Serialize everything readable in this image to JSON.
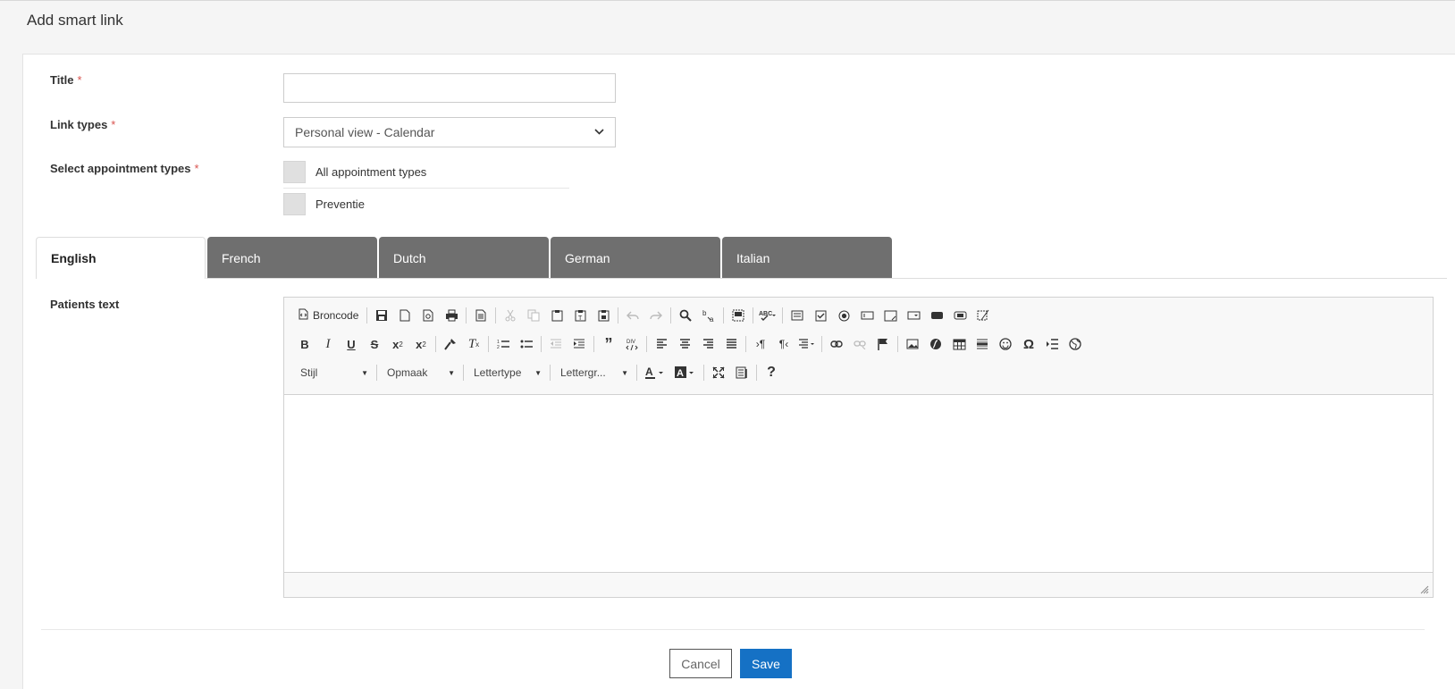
{
  "page": {
    "title": "Add smart link"
  },
  "form": {
    "title": {
      "label": "Title",
      "required": "*",
      "value": "",
      "placeholder": ""
    },
    "link_types": {
      "label": "Link types",
      "required": "*",
      "selected": "Personal view - Calendar"
    },
    "appointment_types": {
      "label": "Select appointment types",
      "required": "*",
      "options": [
        {
          "label": "All appointment types",
          "checked": false
        },
        {
          "label": "Preventie",
          "checked": false
        }
      ]
    },
    "patients_text": {
      "label": "Patients text"
    }
  },
  "tabs": [
    {
      "label": "English",
      "active": true
    },
    {
      "label": "French",
      "active": false
    },
    {
      "label": "Dutch",
      "active": false
    },
    {
      "label": "German",
      "active": false
    },
    {
      "label": "Italian",
      "active": false
    }
  ],
  "editor": {
    "source_label": "Broncode",
    "combos": {
      "style": "Stijl",
      "format": "Opmaak",
      "font": "Lettertype",
      "size": "Lettergr..."
    }
  },
  "buttons": {
    "cancel": "Cancel",
    "save": "Save"
  },
  "colors": {
    "primary": "#1571c5",
    "tab_inactive": "#6f6f6f",
    "required": "#d9534f"
  }
}
